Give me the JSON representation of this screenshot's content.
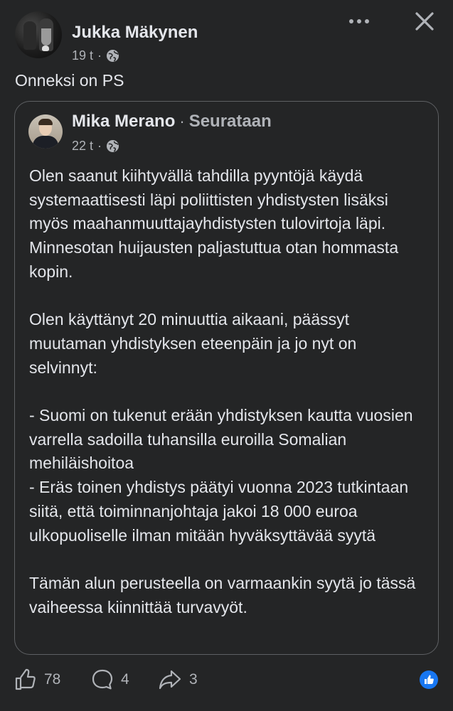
{
  "post": {
    "author": "Jukka Mäkynen",
    "time": "19 t",
    "dot": "·",
    "text": "Onneksi on PS"
  },
  "shared": {
    "author": "Mika Merano",
    "separator": "·",
    "follow_status": "Seurataan",
    "time": "22 t",
    "dot": "·",
    "paragraphs": [
      "Olen saanut kiihtyvällä tahdilla pyyntöjä käydä systemaattisesti läpi poliittisten yhdistysten lisäksi myös maahanmuuttajayhdistysten tulovirtoja läpi. Minnesotan huijausten paljastuttua otan hommasta kopin.",
      "Olen käyttänyt 20 minuuttia aikaani, päässyt muutaman yhdistyksen eteenpäin ja jo nyt on selvinnyt:",
      "- Suomi on tukenut erään yhdistyksen kautta vuosien varrella sadoilla tuhansilla euroilla Somalian mehiläishoitoa",
      "- Eräs toinen yhdistys päätyi vuonna 2023 tutkintaan siitä, että toiminnanjohtaja jakoi 18 000 euroa ulkopuoliselle ilman mitään hyväksyttävää syytä",
      "Tämän alun perusteella on varmaankin syytä jo tässä vaiheessa kiinnittää turvavyöt."
    ]
  },
  "actions": {
    "likes": "78",
    "comments": "4",
    "shares": "3"
  },
  "icons": {
    "header": [
      "more-icon",
      "close-icon",
      "globe-icon"
    ],
    "footer": [
      "like-icon",
      "comment-icon",
      "share-icon",
      "like-reaction-icon"
    ]
  },
  "colors": {
    "background": "#242526",
    "text": "#e4e6eb",
    "secondary_text": "#b0b3b8",
    "card_border": "#5e6063",
    "reaction_blue": "#1877f2"
  }
}
